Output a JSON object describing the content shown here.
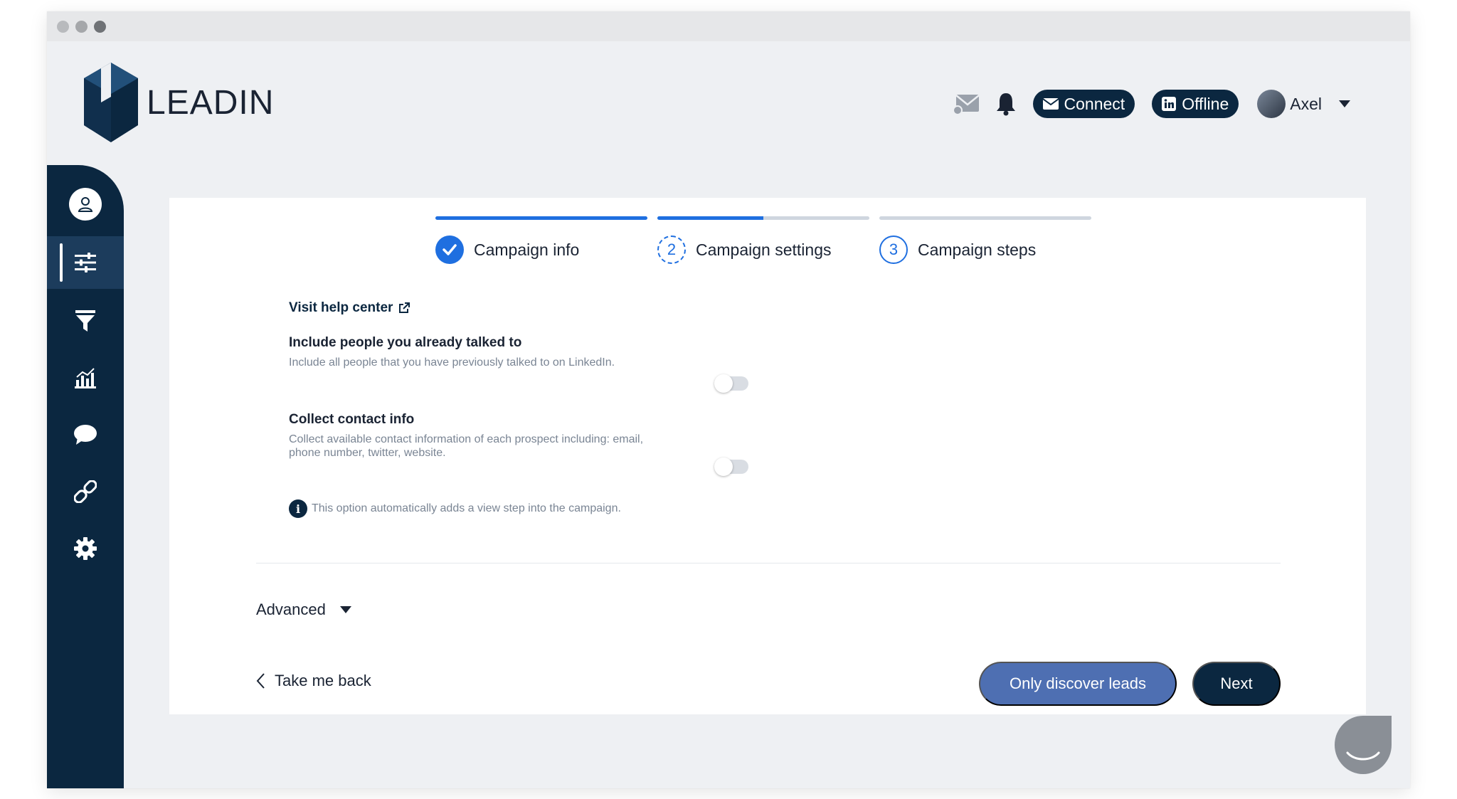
{
  "window": {
    "dot_colors": [
      "#b8babd",
      "#a5a7aa",
      "#6f7276"
    ]
  },
  "brand": {
    "name": "LEADIN",
    "primary_color": "#0b2740",
    "accent_color": "#1f6fe0"
  },
  "topbar": {
    "mail_icon": "mail-icon",
    "bell_icon": "bell-icon",
    "connect_label": "Connect",
    "linkedin_status_label": "Offline",
    "user_name": "Axel"
  },
  "sidebar": {
    "items": [
      {
        "icon": "user-icon"
      },
      {
        "icon": "sliders-icon",
        "active": true
      },
      {
        "icon": "funnel-icon"
      },
      {
        "icon": "bar-chart-icon"
      },
      {
        "icon": "chat-icon"
      },
      {
        "icon": "link-icon"
      },
      {
        "icon": "gear-icon"
      }
    ]
  },
  "stepper": {
    "steps": [
      {
        "label": "Campaign info",
        "number": "",
        "state": "done",
        "progress": 1.0
      },
      {
        "label": "Campaign settings",
        "number": "2",
        "state": "current",
        "progress": 0.5
      },
      {
        "label": "Campaign steps",
        "number": "3",
        "state": "todo",
        "progress": 0.0
      }
    ]
  },
  "form": {
    "help_link_label": "Visit help center",
    "options": [
      {
        "title": "Include people you already talked to",
        "description": "Include all people that you have previously talked to on LinkedIn.",
        "enabled": false
      },
      {
        "title": "Collect contact info",
        "description": "Collect available contact information of each prospect including: email, phone number, twitter, website.",
        "enabled": false
      }
    ],
    "note_icon_glyph": "i",
    "note": "This option automatically adds a view step into the campaign.",
    "advanced_label": "Advanced"
  },
  "actions": {
    "back_label": "Take me back",
    "secondary_label": "Only discover leads",
    "primary_label": "Next"
  }
}
